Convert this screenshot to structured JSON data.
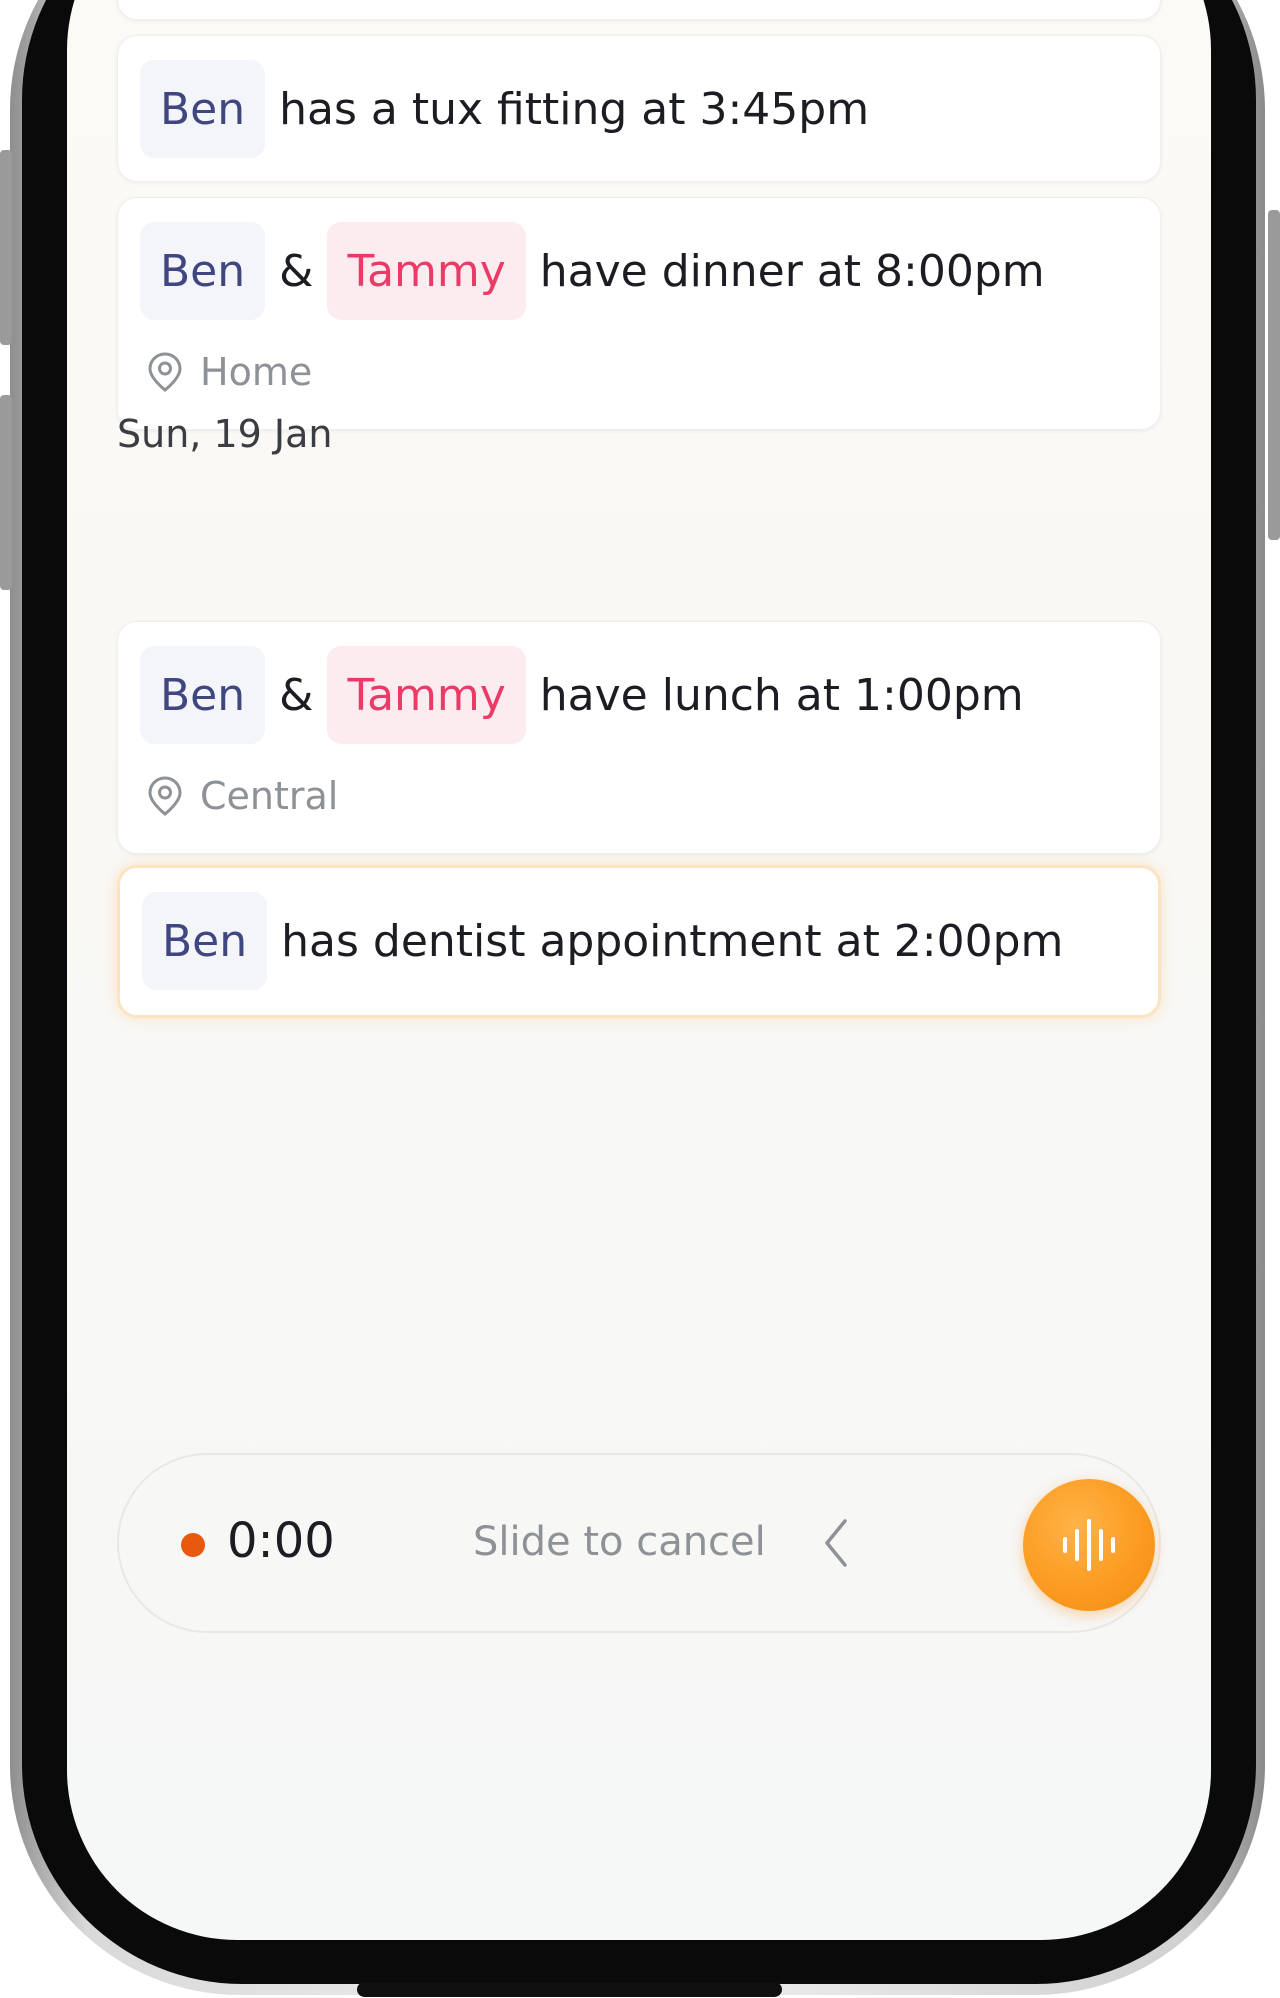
{
  "events": [
    {
      "who": [
        "Ben"
      ],
      "text": "has a tux fitting at 3:45pm"
    },
    {
      "who": [
        "Ben",
        "Tammy"
      ],
      "joiner": "&",
      "text": "have dinner at 8:00pm",
      "location": "Home"
    }
  ],
  "date_group": {
    "label": "Sun, 19 Jan"
  },
  "events_sun": [
    {
      "who": [
        "Ben",
        "Tammy"
      ],
      "joiner": "&",
      "text": "have lunch at 1:00pm",
      "location": "Central"
    },
    {
      "who": [
        "Ben"
      ],
      "text": "has dentist appointment at 2:00pm",
      "highlighted": true
    }
  ],
  "recorder": {
    "timer": "0:00",
    "slide_hint": "Slide to cancel",
    "record_color": "#e8590c",
    "mic_color": "#fb9a1f"
  },
  "colors": {
    "ben_text": "#3f4680",
    "tammy_text": "#e93a68"
  }
}
